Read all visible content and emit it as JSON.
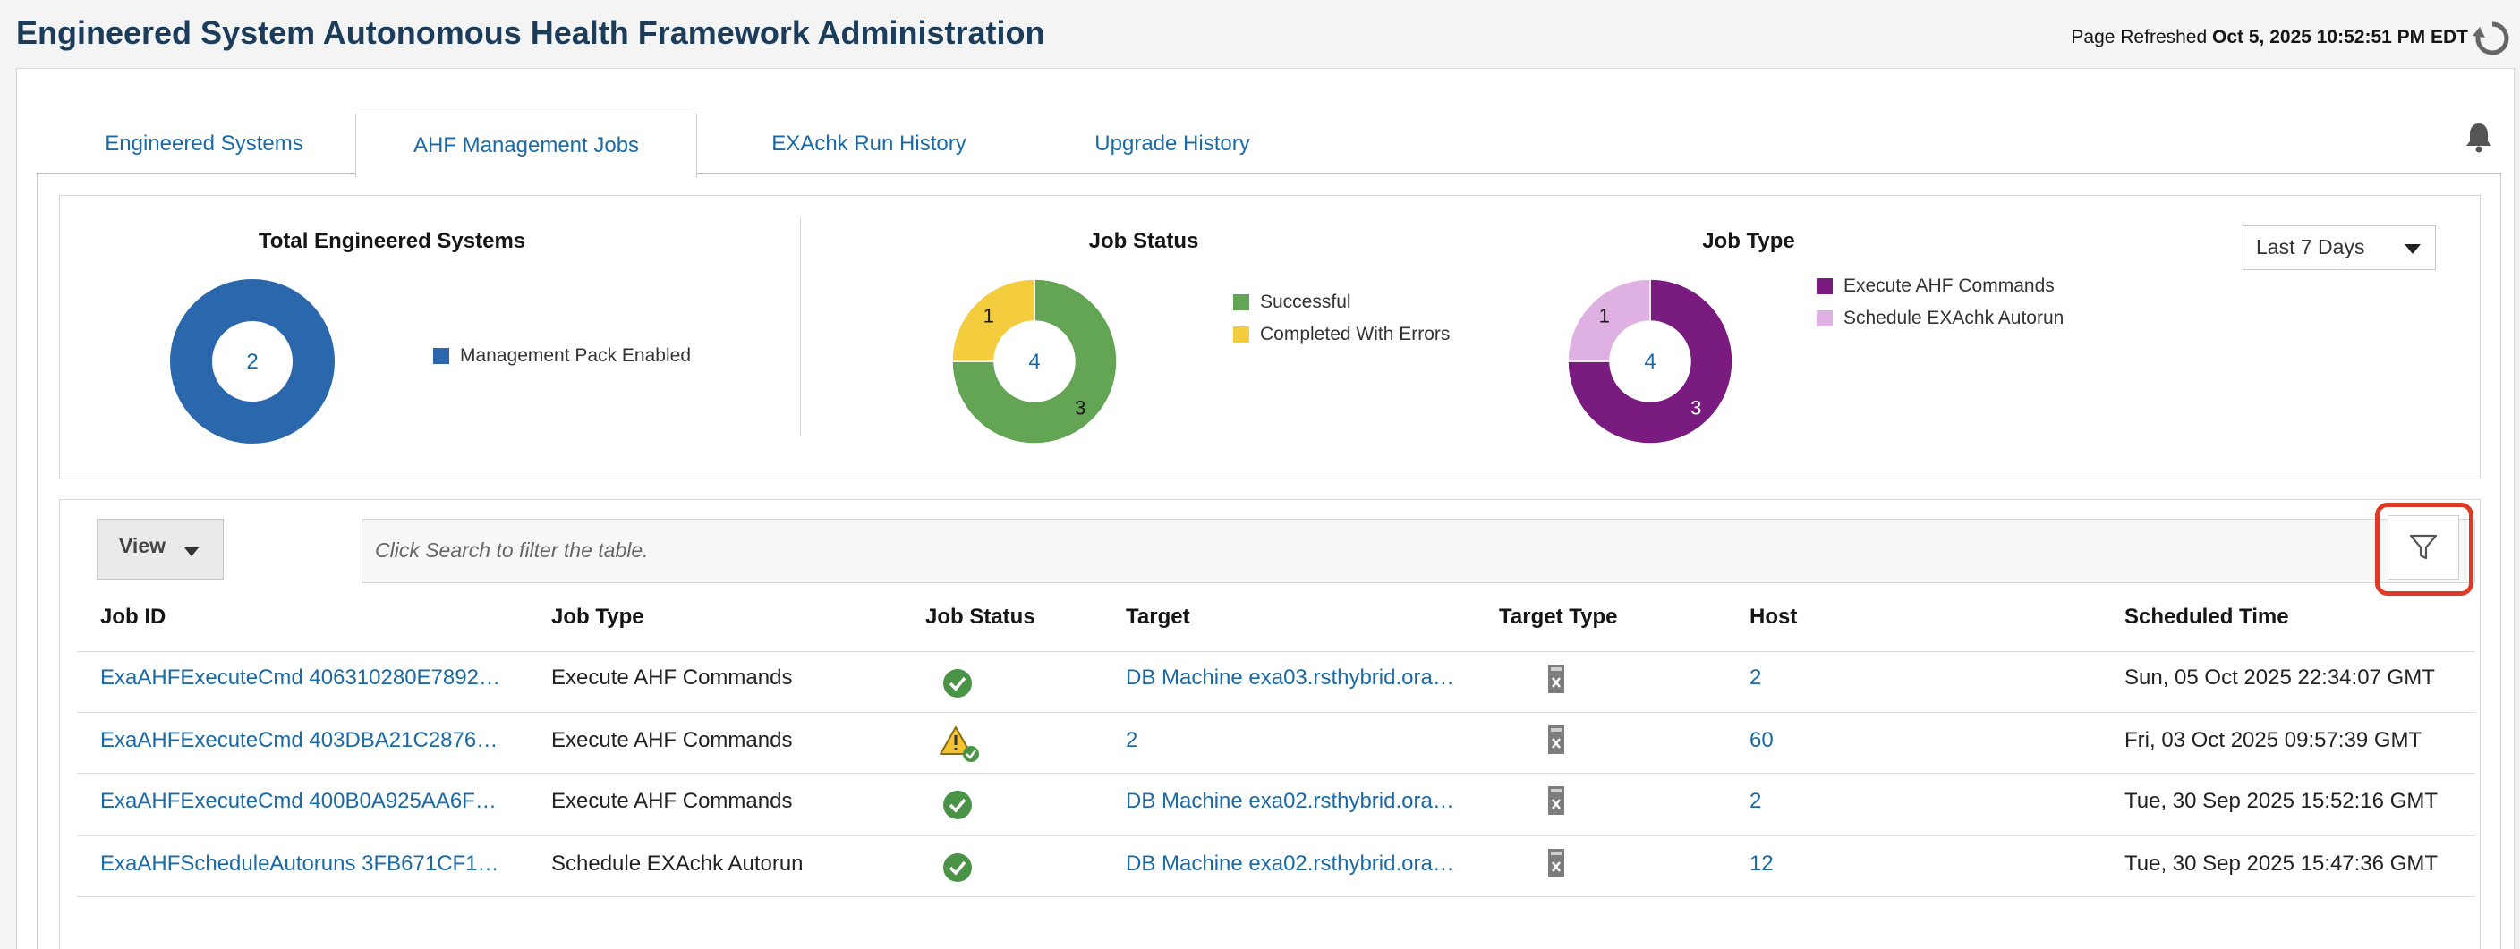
{
  "header": {
    "title": "Engineered System Autonomous Health Framework Administration",
    "refreshed_label": "Page Refreshed",
    "refreshed_time": "Oct 5, 2025 10:52:51 PM EDT"
  },
  "tabs": [
    {
      "label": "Engineered Systems",
      "active": false
    },
    {
      "label": "AHF Management Jobs",
      "active": true
    },
    {
      "label": "EXAchk Run History",
      "active": false
    },
    {
      "label": "Upgrade History",
      "active": false
    }
  ],
  "summary": {
    "period": "Last 7 Days",
    "charts": [
      {
        "title": "Total Engineered Systems"
      },
      {
        "title": "Job Status"
      },
      {
        "title": "Job Type"
      }
    ]
  },
  "chart_data": [
    {
      "type": "pie",
      "title": "Total Engineered Systems",
      "center_label": "2",
      "slices": [
        {
          "label": "Management Pack Enabled",
          "value": 2,
          "color": "#2b67ad"
        }
      ]
    },
    {
      "type": "pie",
      "title": "Job Status",
      "center_label": "4",
      "slices": [
        {
          "label": "Successful",
          "value": 3,
          "color": "#64a455"
        },
        {
          "label": "Completed With Errors",
          "value": 1,
          "color": "#f4cd3e"
        }
      ]
    },
    {
      "type": "pie",
      "title": "Job Type",
      "center_label": "4",
      "slices": [
        {
          "label": "Execute AHF Commands",
          "value": 3,
          "color": "#7a1b80"
        },
        {
          "label": "Schedule EXAchk Autorun",
          "value": 1,
          "color": "#dfb1e3"
        }
      ]
    }
  ],
  "table": {
    "view_label": "View",
    "search_placeholder": "Click Search to filter the table.",
    "columns": [
      "Job ID",
      "Job Type",
      "Job Status",
      "Target",
      "Target Type",
      "Host",
      "Scheduled Time"
    ],
    "rows": [
      {
        "job_id": "ExaAHFExecuteCmd 406310280E7892…",
        "job_type": "Execute AHF Commands",
        "status": "success",
        "target": "DB Machine exa03.rsthybrid.ora…",
        "target_type_icon": "server-icon",
        "host": "2",
        "scheduled": "Sun, 05 Oct 2025 22:34:07 GMT"
      },
      {
        "job_id": "ExaAHFExecuteCmd 403DBA21C2876…",
        "job_type": "Execute AHF Commands",
        "status": "warning",
        "target": "2",
        "target_type_icon": "server-icon",
        "host": "60",
        "scheduled": "Fri, 03 Oct 2025 09:57:39 GMT"
      },
      {
        "job_id": "ExaAHFExecuteCmd 400B0A925AA6F…",
        "job_type": "Execute AHF Commands",
        "status": "success",
        "target": "DB Machine exa02.rsthybrid.ora…",
        "target_type_icon": "server-icon",
        "host": "2",
        "scheduled": "Tue, 30 Sep 2025 15:52:16 GMT"
      },
      {
        "job_id": "ExaAHFScheduleAutoruns 3FB671CF1…",
        "job_type": "Schedule EXAchk Autorun",
        "status": "success",
        "target": "DB Machine exa02.rsthybrid.ora…",
        "target_type_icon": "server-icon",
        "host": "12",
        "scheduled": "Tue, 30 Sep 2025 15:47:36 GMT"
      }
    ]
  }
}
